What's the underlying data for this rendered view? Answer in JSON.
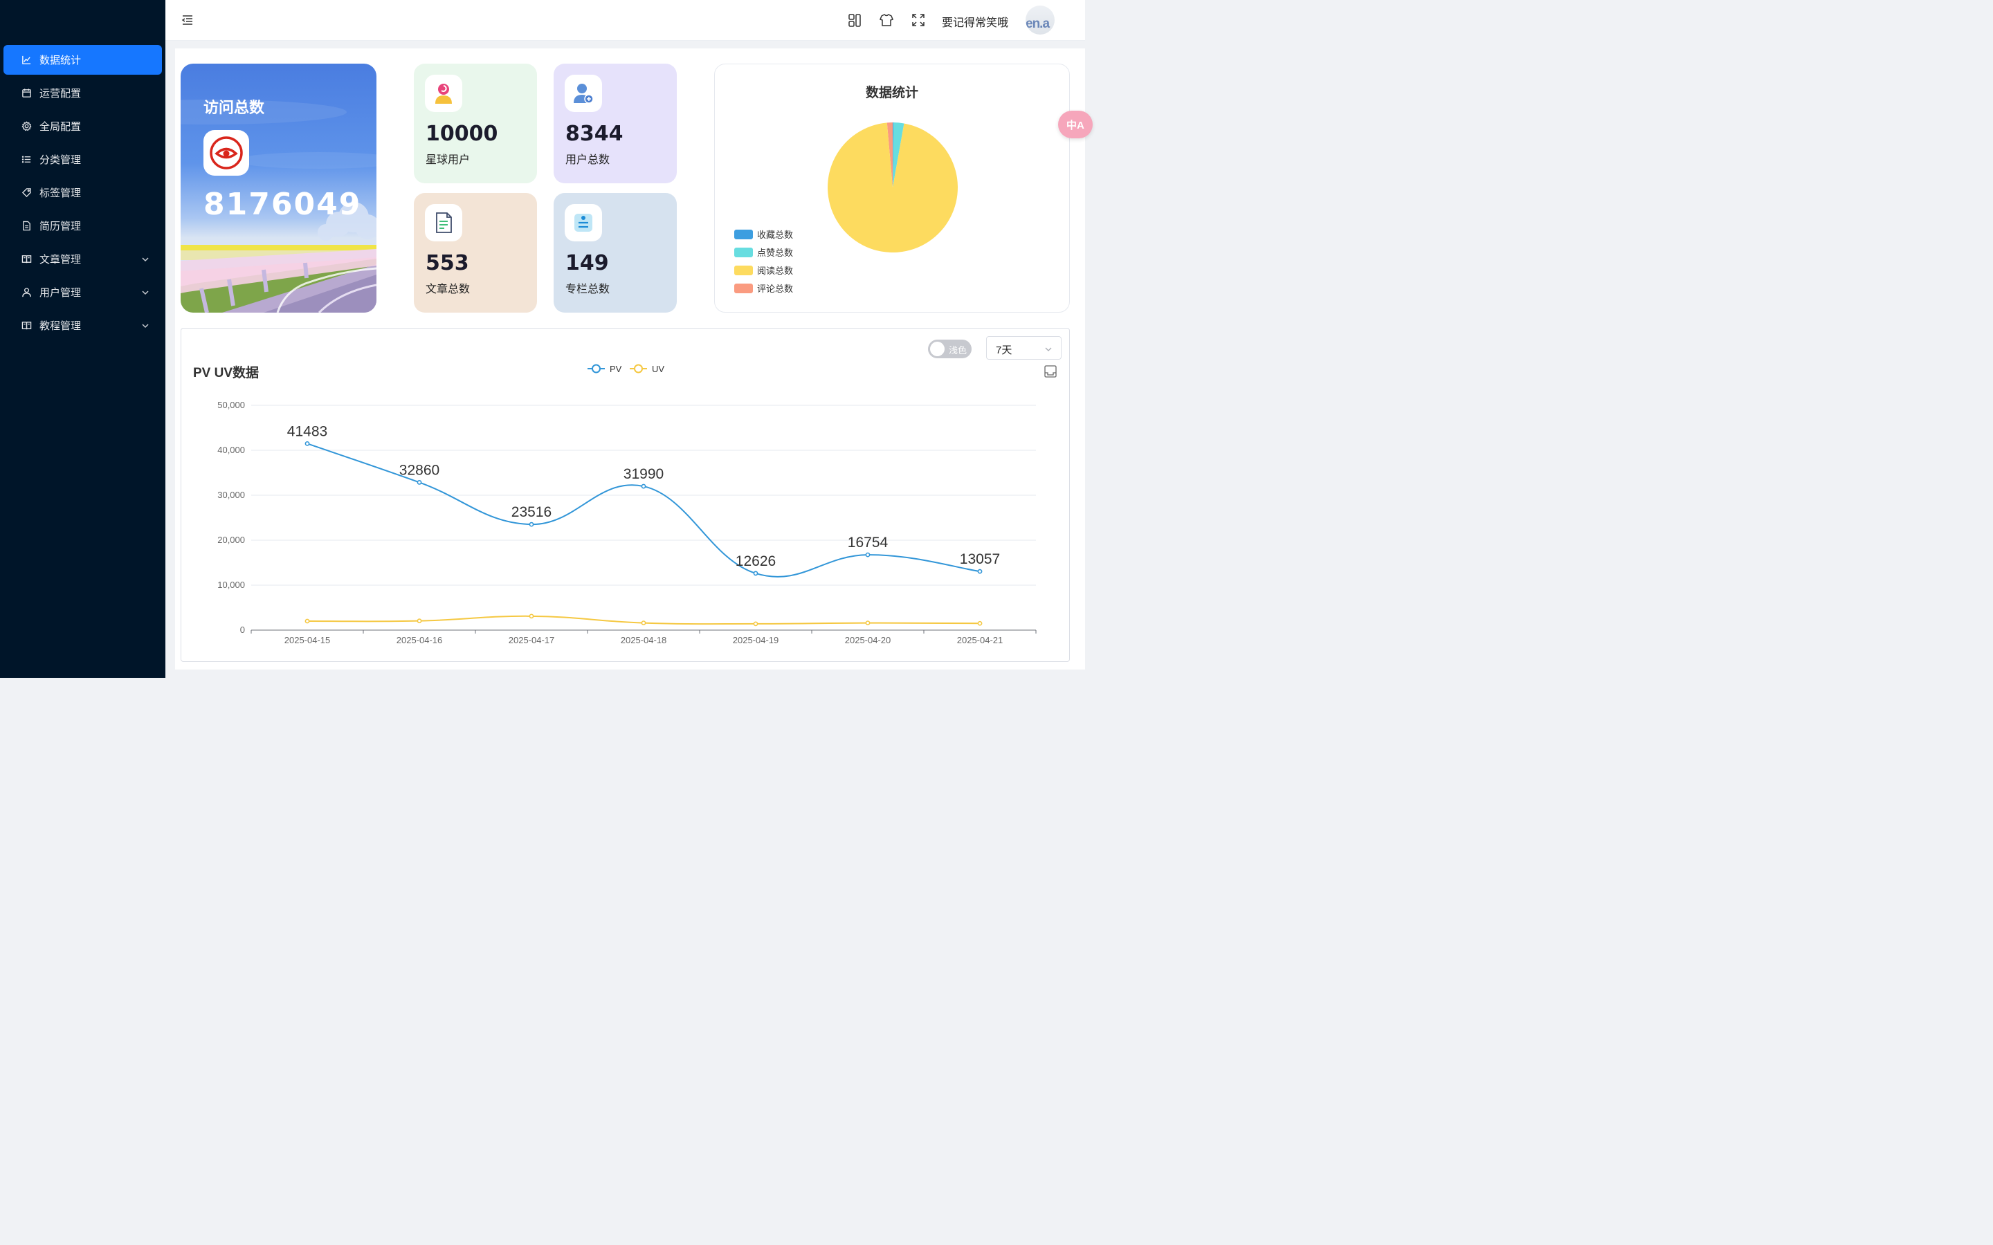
{
  "sidebar": {
    "items": [
      {
        "label": "数据统计",
        "icon": "line-chart-icon",
        "active": true,
        "expandable": false
      },
      {
        "label": "运营配置",
        "icon": "calendar-icon",
        "active": false,
        "expandable": false
      },
      {
        "label": "全局配置",
        "icon": "gear-icon",
        "active": false,
        "expandable": false
      },
      {
        "label": "分类管理",
        "icon": "list-icon",
        "active": false,
        "expandable": false
      },
      {
        "label": "标签管理",
        "icon": "tag-icon",
        "active": false,
        "expandable": false
      },
      {
        "label": "简历管理",
        "icon": "document-icon",
        "active": false,
        "expandable": false
      },
      {
        "label": "文章管理",
        "icon": "book-icon",
        "active": false,
        "expandable": true
      },
      {
        "label": "用户管理",
        "icon": "user-icon",
        "active": false,
        "expandable": true
      },
      {
        "label": "教程管理",
        "icon": "book-icon",
        "active": false,
        "expandable": true
      }
    ]
  },
  "header": {
    "username": "要记得常笑哦",
    "avatar_text": "en.a",
    "icons": [
      "menu-fold-icon",
      "layout-icon",
      "skin-icon",
      "fullscreen-icon"
    ]
  },
  "visit": {
    "title": "访问总数",
    "value": "8176049"
  },
  "stats": [
    {
      "value": "10000",
      "label": "星球用户",
      "icon": "planet-user-icon",
      "bg": "#e9f7ec"
    },
    {
      "value": "8344",
      "label": "用户总数",
      "icon": "add-user-icon",
      "bg": "#e6e2fb"
    },
    {
      "value": "553",
      "label": "文章总数",
      "icon": "article-icon",
      "bg": "#f3e4d6"
    },
    {
      "value": "149",
      "label": "专栏总数",
      "icon": "column-icon",
      "bg": "#d6e2ef"
    }
  ],
  "pie": {
    "title": "数据统计",
    "legend": [
      {
        "name": "收藏总数",
        "color": "#3d9ee0"
      },
      {
        "name": "点赞总数",
        "color": "#67dde0"
      },
      {
        "name": "阅读总数",
        "color": "#fddb5f"
      },
      {
        "name": "评论总数",
        "color": "#fa9b80"
      }
    ]
  },
  "translate_bubble": "中A",
  "pvuv": {
    "title": "PV UV数据",
    "toggle_label": "浅色",
    "range_select": "7天"
  },
  "chart_data": [
    {
      "type": "pie",
      "title": "数据统计",
      "slices": [
        {
          "name": "收藏总数",
          "value": 0.2,
          "color": "#3d9ee0"
        },
        {
          "name": "点赞总数",
          "value": 2.6,
          "color": "#67dde0"
        },
        {
          "name": "阅读总数",
          "value": 95.8,
          "color": "#fddb5f"
        },
        {
          "name": "评论总数",
          "value": 1.4,
          "color": "#fa9b80"
        }
      ],
      "legend_position": "left"
    },
    {
      "type": "line",
      "title": "PV UV数据",
      "categories": [
        "2025-04-15",
        "2025-04-16",
        "2025-04-17",
        "2025-04-18",
        "2025-04-19",
        "2025-04-20",
        "2025-04-21"
      ],
      "series": [
        {
          "name": "PV",
          "color": "#3296d8",
          "values": [
            41483,
            32860,
            23516,
            31990,
            12626,
            16754,
            13057
          ],
          "labels_shown": true
        },
        {
          "name": "UV",
          "color": "#f5c842",
          "values": [
            2000,
            2050,
            3100,
            1600,
            1400,
            1600,
            1500
          ],
          "labels_shown": false
        }
      ],
      "ylim": [
        0,
        50000
      ],
      "yticks": [
        "0",
        "10,000",
        "20,000",
        "30,000",
        "40,000",
        "50,000"
      ],
      "grid": true,
      "legend_position": "top"
    }
  ]
}
